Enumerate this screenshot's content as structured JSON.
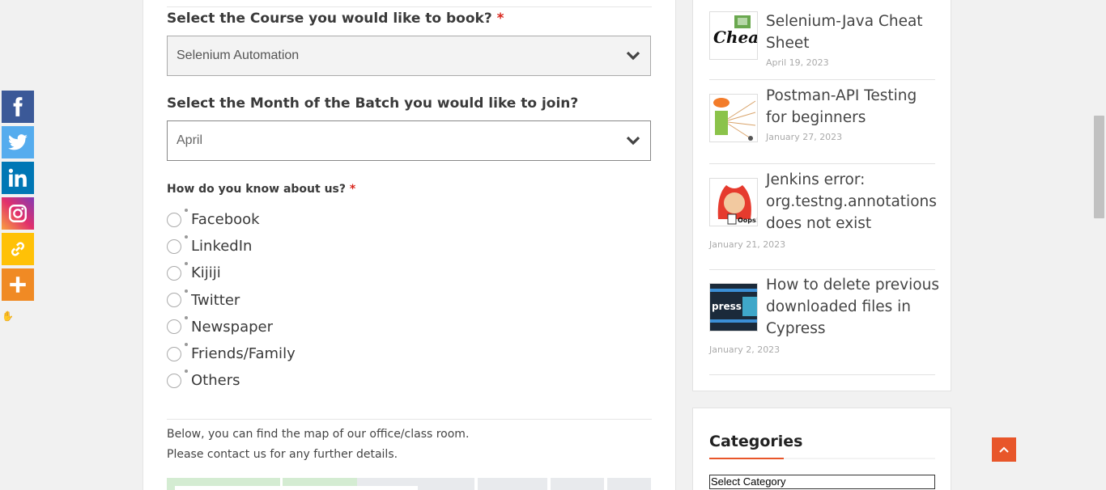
{
  "form": {
    "course_question": "Select the Course you would like to book?",
    "required_mark": "*",
    "course_value": "Selenium Automation",
    "month_question": "Select the Month of the Batch you would like to join?",
    "month_value": "April",
    "how_question": "How do you know about us?",
    "how_options": [
      "Facebook",
      "LinkedIn",
      "Kijiji",
      "Twitter",
      "Newspaper",
      "Friends/Family",
      "Others"
    ],
    "info_line_1": "Below, you can find the map of our office/class room.",
    "info_line_2": "Please contact us for any further details."
  },
  "share": {
    "items": [
      {
        "name": "Facebook",
        "color": "#3b5998",
        "icon": "facebook-icon"
      },
      {
        "name": "Twitter",
        "color": "#55acee",
        "icon": "twitter-icon"
      },
      {
        "name": "LinkedIn",
        "color": "#0077b5",
        "icon": "linkedin-icon"
      },
      {
        "name": "Instagram",
        "color": "#c13584",
        "icon": "instagram-icon"
      },
      {
        "name": "Copy Link",
        "color": "#ffc107",
        "icon": "link-icon"
      },
      {
        "name": "More",
        "color": "#f08a24",
        "icon": "plus-icon"
      }
    ],
    "hide_glyph": "✋"
  },
  "sidebar": {
    "posts": [
      {
        "title": "Selenium-Java Cheat Sheet",
        "date": "April 19, 2023",
        "thumb_text": "Cheat SHE"
      },
      {
        "title": "Postman-API Testing for beginners",
        "date": "January 27, 2023"
      },
      {
        "title": "Jenkins error: org.testng.annotations does not exist",
        "date": "January 21, 2023",
        "thumb_text": "Oops!"
      },
      {
        "title": "How to delete previous downloaded files in Cypress",
        "date": "January 2, 2023",
        "thumb_text": "press"
      }
    ],
    "categories_title": "Categories",
    "categories_select": "Select Category"
  },
  "colors": {
    "accent": "#e8562a",
    "required": "#d9261c"
  }
}
